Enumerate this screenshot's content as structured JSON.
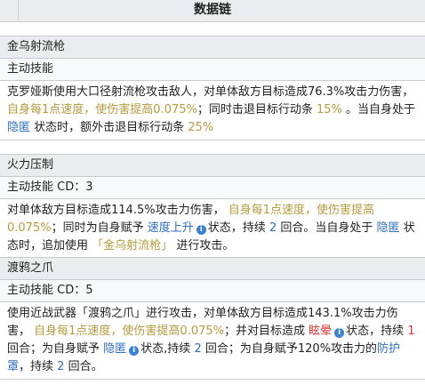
{
  "header": {
    "title": "数据链"
  },
  "skills": [
    {
      "name": "金乌射流枪",
      "type": "主动技能",
      "desc": {
        "p1": "克罗娅斯使用大口径射流枪攻击敌人，对单体敌方目标造成76.3%攻击力伤害，",
        "g1": "自身每1点速度，使伤害提高0.075%",
        "p2": "；同时击退目标行动条",
        "g2": "15%",
        "p3": "。当自身处于",
        "b1": "隐匿",
        "p4": "状态时，额外击退目标行动条",
        "g3": "25%"
      }
    },
    {
      "name": "火力压制",
      "type": "主动技能 CD：3",
      "desc": {
        "p1": "对单体敌方目标造成114.5%攻击力伤害，",
        "g1": "自身每1点速度，使伤害提高0.075%",
        "p2": "；同时为自身赋予",
        "b1": "速度上升",
        "p3": "状态，持续",
        "b2": "2",
        "p4": "回合。当自身处于",
        "b3": "隐匿",
        "p5": "状态时，追加使用",
        "q1": "「金乌射流枪」",
        "p6": "进行攻击。"
      }
    },
    {
      "name": "渡鸦之爪",
      "type": "主动技能 CD：5",
      "desc": {
        "p1": "使用近战武器「渡鸦之爪」进行攻击，对单体敌方目标造成143.1%攻击力伤害，",
        "g1": "自身每1点速度，使伤害提高0.075%",
        "p2": "；并对目标造成",
        "r1": "眩晕",
        "p3": "状态，持续",
        "r2": "1",
        "p4": "回合；为自身赋予",
        "b1": "隐匿",
        "p5": "状态,持续",
        "b2": "2",
        "p6": "回合；为自身赋予120%攻击力的",
        "b3": "防护罩",
        "p7": "，持续",
        "b4": "2",
        "p8": "回合。"
      }
    }
  ]
}
